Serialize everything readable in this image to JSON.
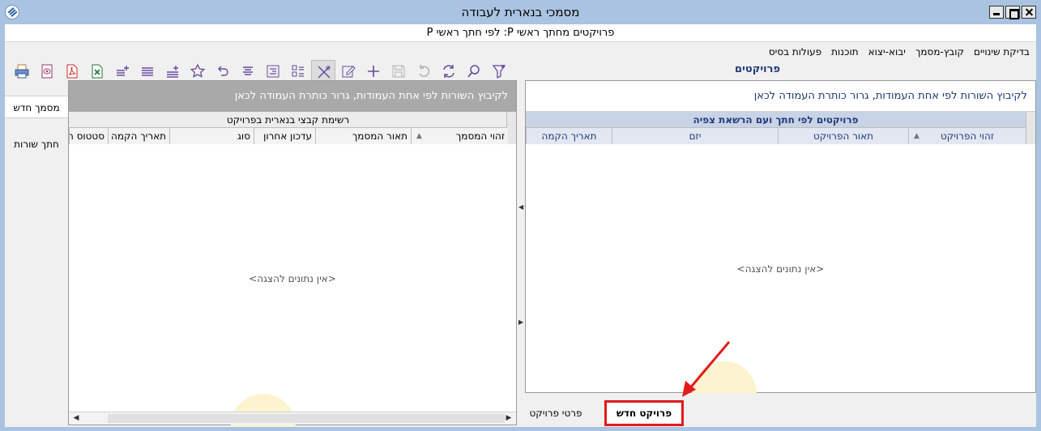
{
  "window": {
    "title": "מסמכי בנארית לעבודה",
    "subtitle": "פרויקטים מחתך ראשי P: לפי חתך ראשי P"
  },
  "menu": {
    "items": [
      "פעולות בסיס",
      "תוכנות",
      "יבוא-יצוא",
      "קובץ-מסמך",
      "בדיקת שינויים"
    ]
  },
  "toolbar": {
    "icons": [
      "print-icon",
      "preview-icon",
      "pdf-icon",
      "excel-icon",
      "sort-plus-icon",
      "list-icon",
      "sort-ascending-icon",
      "star-icon",
      "undo-arrow-icon",
      "align-center-icon",
      "indent-icon",
      "sort-az-icon",
      "tools-icon",
      "edit-icon",
      "add-icon",
      "save-icon",
      "undo-icon",
      "refresh-icon",
      "search-icon",
      "filter-icon"
    ]
  },
  "projects_title": "פרויקטים",
  "left_sidebar": {
    "new_doc": "מסמך חדש",
    "split_rows": "חתך שורות"
  },
  "left_panel": {
    "group_hint": "לקיבוץ השורות לפי אחת העמודות, גרור כותרת העמודה לכאן",
    "band_title": "רשימת קבצי בנארית בפרויקט",
    "columns": [
      "זהוי המסמך",
      "תאור המסמך",
      "עדכון אחרון",
      "סוג",
      "תאריך הקמה",
      "סטטוס ה"
    ],
    "empty": "<אין נתונים להצגה>"
  },
  "right_panel": {
    "group_hint": "לקיבוץ השורות לפי אחת העמודות, גרור כותרת העמודה לכאן",
    "band_title": "פרויקטים לפי חתך ועם הרשאת צפיה",
    "columns": [
      "זהוי הפרויקט",
      "תאור הפרויקט",
      "יזם",
      "תאריך הקמה"
    ],
    "empty": "<אין נתונים להצגה>"
  },
  "bottom_tabs": {
    "details": "פרטי פרויקט",
    "new_project": "פרויקט חדש"
  },
  "colors": {
    "highlight": "#e31b1b",
    "accent": "#1f3a7a"
  }
}
